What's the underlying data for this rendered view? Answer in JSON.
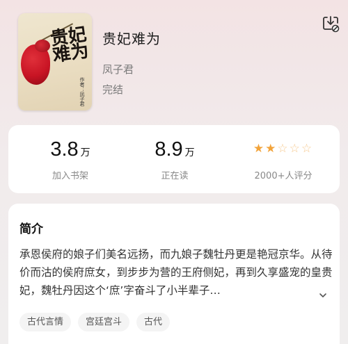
{
  "book": {
    "title": "贵妃难为",
    "author": "凤子君",
    "status": "完结",
    "cover": {
      "title_chars": "贵妃难为",
      "subtitle": "作者：凤子君"
    }
  },
  "download_icon": "download-icon",
  "stats": [
    {
      "number": "3.8",
      "unit": "万",
      "label": "加入书架"
    },
    {
      "number": "8.9",
      "unit": "万",
      "label": "正在读"
    }
  ],
  "rating": {
    "stars_filled": 2,
    "stars_total": 5,
    "label": "2000+人评分",
    "star_color": "#f2a33a"
  },
  "intro": {
    "heading": "简介",
    "text": "承恩侯府的娘子们美名远扬，而九娘子魏牡丹更是艳冠京华。从待价而沽的侯府庶女，到步步为营的王府侧妃，再到久享盛宠的皇贵妃，魏牡丹因这个‘庶’字奋斗了小半辈子…",
    "expand_icon": "chevron-down-icon"
  },
  "tags": [
    "古代言情",
    "宫廷宫斗",
    "古代"
  ]
}
